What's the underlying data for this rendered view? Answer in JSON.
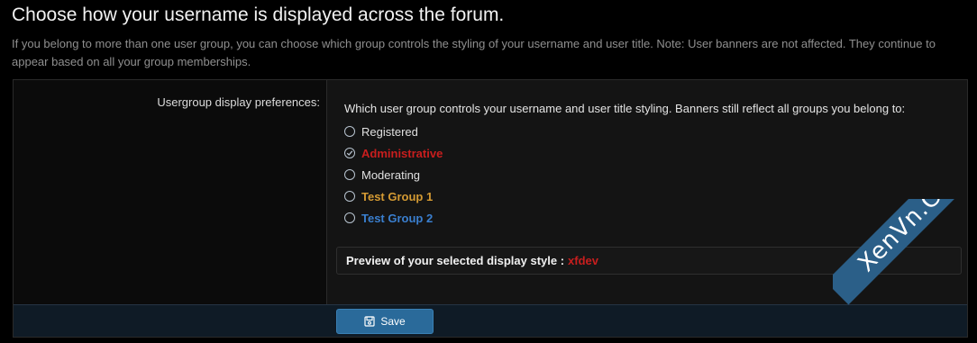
{
  "page": {
    "title": "Choose how your username is displayed across the forum.",
    "description": "If you belong to more than one user group, you can choose which group controls the styling of your username and user title. Note: User banners are not affected. They continue to appear based on all your group memberships."
  },
  "form": {
    "label": "Usergroup display preferences:",
    "explain": "Which user group controls your username and user title styling. Banners still reflect all groups you belong to:",
    "options": [
      {
        "label": "Registered",
        "color": "#e0e0e0",
        "bold": false,
        "checked": false
      },
      {
        "label": "Administrative",
        "color": "#c81e1e",
        "bold": true,
        "checked": true
      },
      {
        "label": "Moderating",
        "color": "#e0e0e0",
        "bold": false,
        "checked": false
      },
      {
        "label": "Test Group 1",
        "color": "#d49a33",
        "bold": true,
        "checked": false
      },
      {
        "label": "Test Group 2",
        "color": "#3a7fcf",
        "bold": true,
        "checked": false
      }
    ],
    "preview": {
      "label": "Preview of your selected display style :",
      "username": "xfdev",
      "username_color": "#c81e1e"
    },
    "save_label": "Save",
    "save_icon": "save-icon"
  },
  "watermark": {
    "text": "XenVn.Com"
  }
}
